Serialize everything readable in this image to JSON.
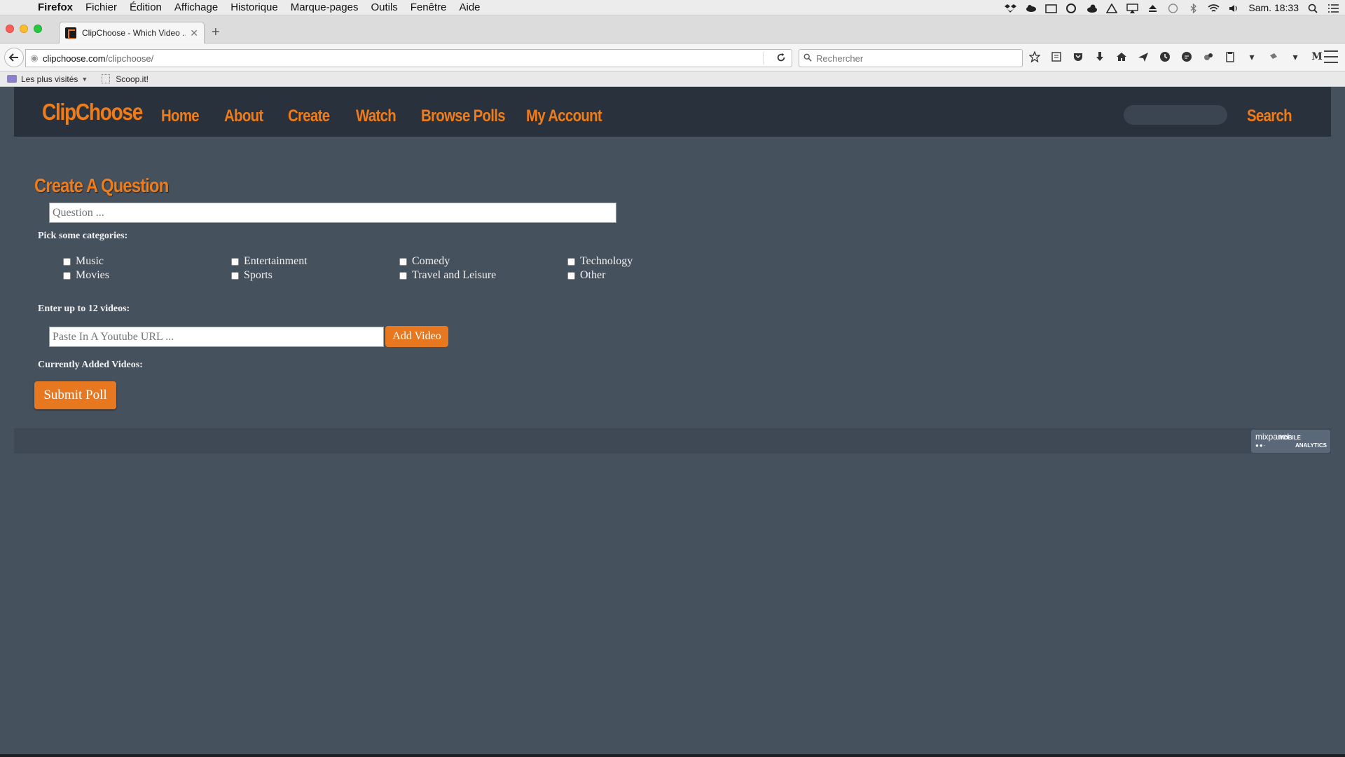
{
  "mac_menubar": {
    "app": "Firefox",
    "items": [
      "Fichier",
      "Édition",
      "Affichage",
      "Historique",
      "Marque-pages",
      "Outils",
      "Fenêtre",
      "Aide"
    ],
    "clock": "Sam. 18:33"
  },
  "browser": {
    "tab_title": "ClipChoose - Which Video ...",
    "url_host": "clipchoose.com",
    "url_path": "/clipchoose/",
    "search_placeholder": "Rechercher",
    "bookmarks": [
      {
        "label": "Les plus visités"
      },
      {
        "label": "Scoop.it!"
      }
    ]
  },
  "site": {
    "logo": "ClipChoose",
    "nav": [
      "Home",
      "About",
      "Create",
      "Watch",
      "Browse Polls",
      "My Account"
    ],
    "search_button": "Search",
    "accent_color": "#ee7c1a",
    "background_color": "#46515e"
  },
  "form": {
    "heading": "Create A Question",
    "question_placeholder": "Question ...",
    "categories_label": "Pick some categories:",
    "categories": [
      "Music",
      "Entertainment",
      "Comedy",
      "Technology",
      "Movies",
      "Sports",
      "Travel and Leisure",
      "Other"
    ],
    "videos_label": "Enter up to 12 videos:",
    "url_placeholder": "Paste In A Youtube URL ...",
    "add_video": "Add Video",
    "current_label": "Currently Added Videos:",
    "submit": "Submit Poll"
  },
  "footer": {
    "badge_name": "mixpanel",
    "badge_sub_1": "MOBILE",
    "badge_sub_2": "ANALYTICS"
  }
}
